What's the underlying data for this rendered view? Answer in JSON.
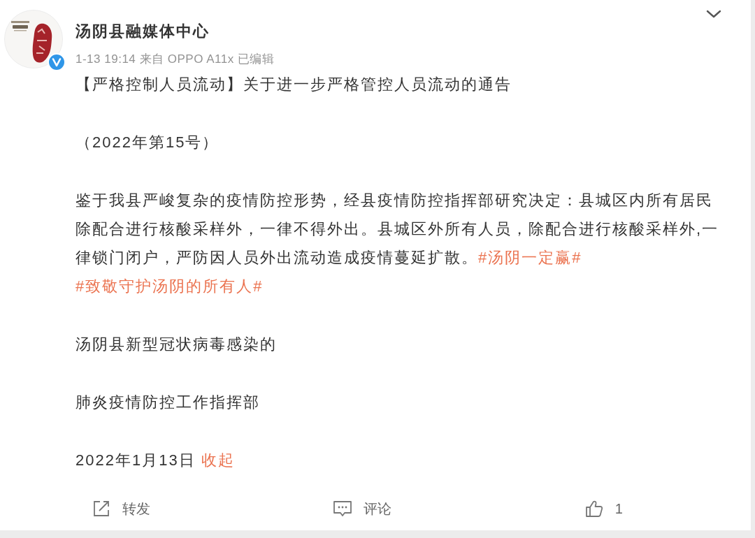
{
  "post": {
    "author": {
      "name": "汤阴县融媒体中心",
      "verified": true
    },
    "meta": "1-13 19:14 来自 OPPO A11x 已编辑",
    "body": [
      {
        "kind": "text",
        "text": "【严格控制人员流动】关于进一步严格管控人员流动的通告"
      },
      {
        "kind": "text",
        "text": "（2022年第15号）"
      },
      {
        "kind": "paragraph",
        "text": "鉴于我县严峻复杂的疫情防控形势，经县疫情防控指挥部研究决定：县城区内所有居民除配合进行核酸采样外，一律不得外出。县城区外所有人员，除配合进行核酸采样外,一律锁门闭户，严防因人员外出流动造成疫情蔓延扩散。",
        "hashtags": [
          "#汤阴一定赢#",
          "#致敬守护汤阴的所有人#"
        ]
      },
      {
        "kind": "text",
        "text": "汤阴县新型冠状病毒感染的"
      },
      {
        "kind": "text",
        "text": "肺炎疫情防控工作指挥部"
      },
      {
        "kind": "date",
        "text": "2022年1月13日",
        "link": "收起"
      }
    ],
    "actions": [
      {
        "kind": "repost",
        "label": "转发"
      },
      {
        "kind": "comment",
        "label": "评论"
      },
      {
        "kind": "like",
        "label": "1"
      }
    ]
  }
}
